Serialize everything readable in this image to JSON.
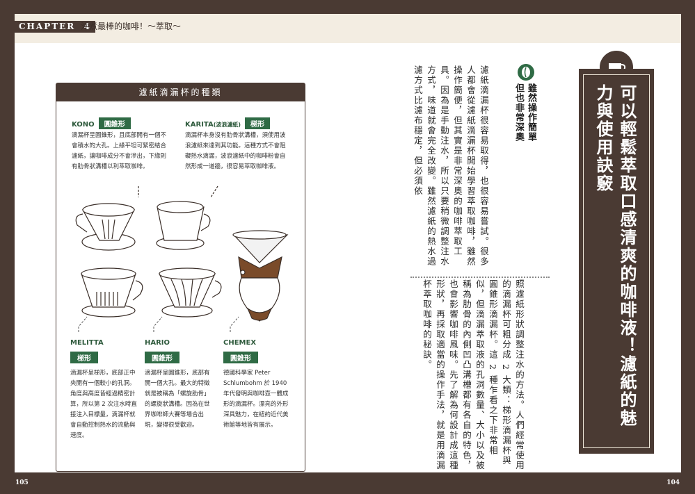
{
  "header": {
    "chapter": "CHAPTER",
    "chapter_num": "4",
    "title": "沖煮最棒的咖啡！～萃取～"
  },
  "pages": {
    "left": "105",
    "right": "104"
  },
  "box": {
    "title": "濾紙滴漏杯的種類",
    "kono": {
      "name": "KONO",
      "tag": "圓錐形",
      "desc": "滴漏杯呈圓錐形，且底部開有一個不會積水的大孔。上緣平坦可緊密結合濾紙，讓咖啡成分不會滲出，下緣則有肋骨狀溝槽以利萃取咖啡。"
    },
    "karita": {
      "name": "KARITA",
      "sub": "(波浪濾紙)",
      "tag": "梯形",
      "desc": "滴漏杯本身沒有肋骨狀溝槽，須使用波浪濾紙來達到其功能。這種方式不會阻礙熱水滴漏，波浪濾紙中的咖啡粉會自然形成一道牆，很容易萃取咖啡液。"
    },
    "melitta": {
      "name": "MELITTA",
      "tag": "梯形",
      "desc": "滴漏杯呈梯形，底部正中央開有一個較小的孔洞。角度與高度皆經過精密計算，所以第 2 次注水時直接注入目標量，滴漏杯就會自動控制熱水的流動與速度。"
    },
    "hario": {
      "name": "HARIO",
      "tag": "圓錐形",
      "desc": "滴漏杯呈圓錐形，底部有開一個大孔。最大的特徵就是被稱為「螺旋肋骨」的螺旋狀溝槽。因為在世界咖啡師大賽等場合出現，變得很受歡迎。"
    },
    "chemex": {
      "name": "CHEMEX",
      "tag": "圓錐形",
      "desc": "德國科學家 Peter Schlumbohm 於 1940 年代發明與咖啡壺一體成形的滴漏杯。漂亮的外形深具魅力，在紐約近代美術館等地皆有展示。"
    }
  },
  "right": {
    "title": "可以輕鬆萃取口感清爽的咖啡液！濾紙的魅力與使用訣竅",
    "heading_line1": "雖然操作簡單",
    "heading_line2": "但也非常深奧",
    "para1": "濾紙滴漏杯很容易取得，也很容易嘗試。很多人都會從濾紙滴漏杯開始學習萃取咖啡，雖然操作簡便，但其實是非常深奧的咖啡萃取工具。因為是手動注水，所以只要稍微調整注水方式，味道就會完全改變。雖然濾紙的熱水過濾方式比濾布穩定，但必須依",
    "para2": "照濾紙形狀調整注水的方法。人們經常使用的滴漏杯可粗分成 2 大類：梯形滴漏杯與圓錐形滴漏杯。這 2 種乍看之下非常相似，但滴漏萃取液的孔洞數量、大小以及被稱為肋骨的內側凹凸溝槽都有各自的特色，也會影響咖啡風味。先了解為何設計成這種形狀，再採取適當的操作手法，就是用滴漏杯萃取咖啡的秘訣。"
  }
}
